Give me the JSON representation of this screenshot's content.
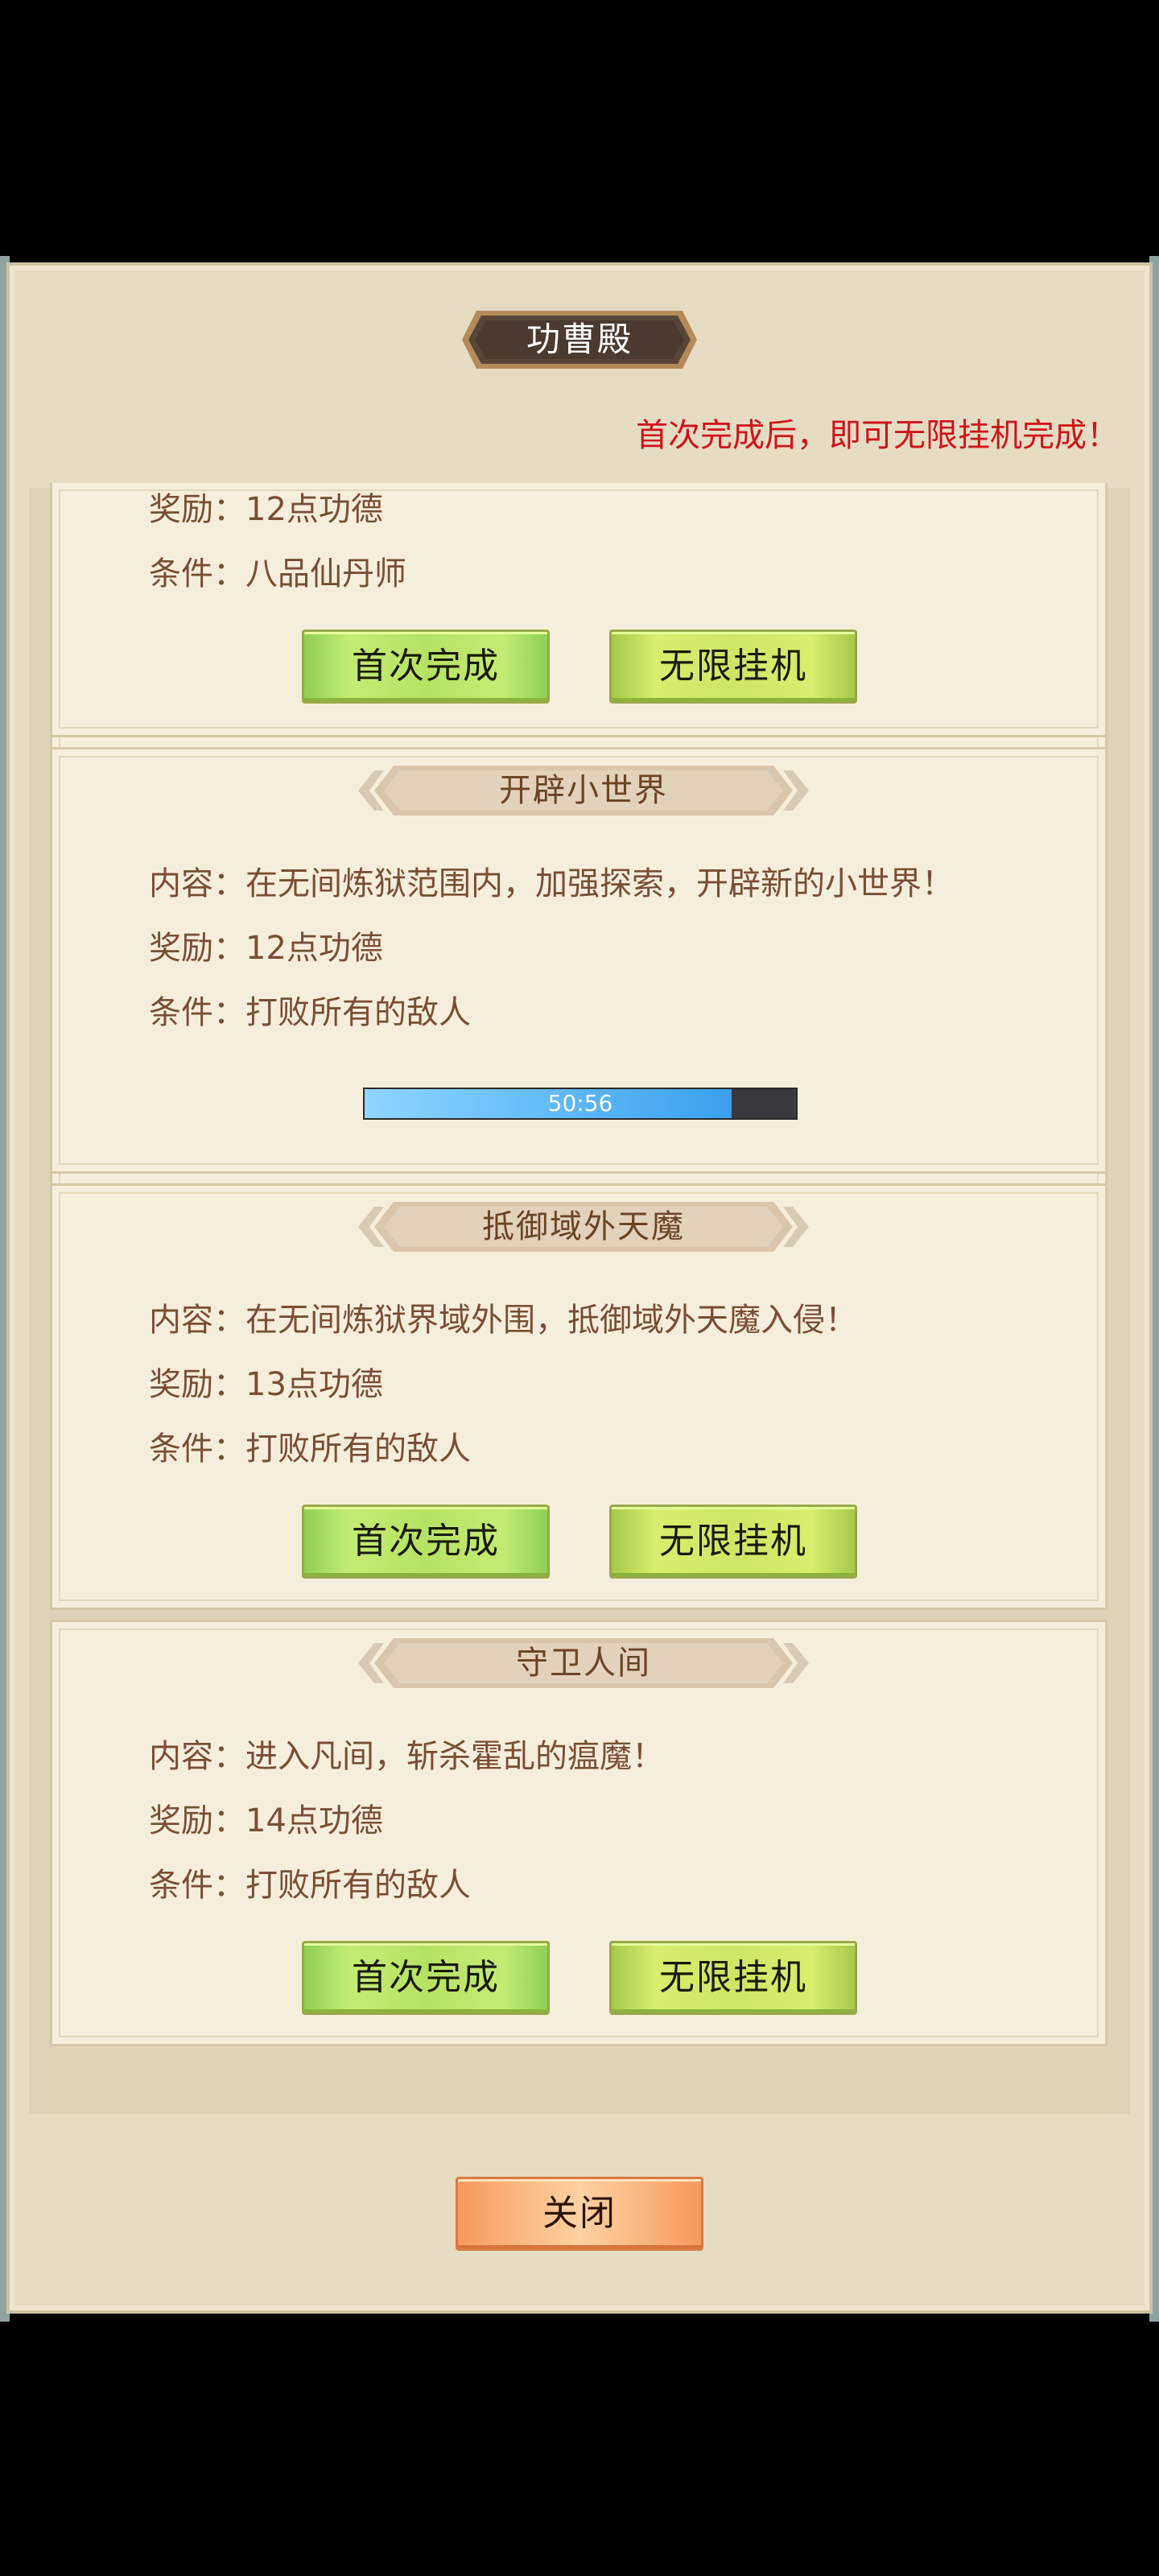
{
  "window_title": "功曹殿",
  "hint": "首次完成后，即可无限挂机完成！",
  "labels": {
    "content": "内容：",
    "reward": "奖励：",
    "condition": "条件："
  },
  "buttons": {
    "first_complete": "首次完成",
    "auto_idle": "无限挂机",
    "close": "关闭"
  },
  "cards": [
    {
      "title": "",
      "reward": "12点功德",
      "condition": "八品仙丹师",
      "action": "buttons"
    },
    {
      "title": "开辟小世界",
      "content": "在无间炼狱范围内，加强探索，开辟新的小世界！",
      "reward": "12点功德",
      "condition": "打败所有的敌人",
      "action": "progress",
      "progress": {
        "label": "50:56",
        "fraction": 0.85
      }
    },
    {
      "title": "抵御域外天魔",
      "content": "在无间炼狱界域外围，抵御域外天魔入侵！",
      "reward": "13点功德",
      "condition": "打败所有的敌人",
      "action": "buttons"
    },
    {
      "title": "守卫人间",
      "content": "进入凡间，斩杀霍乱的瘟魔！",
      "reward": "14点功德",
      "condition": "打败所有的敌人",
      "action": "buttons"
    }
  ],
  "colors": {
    "hint": "#d0141a",
    "text_brown": "#7a4e34",
    "progress_fill": "#3aa0ef"
  }
}
